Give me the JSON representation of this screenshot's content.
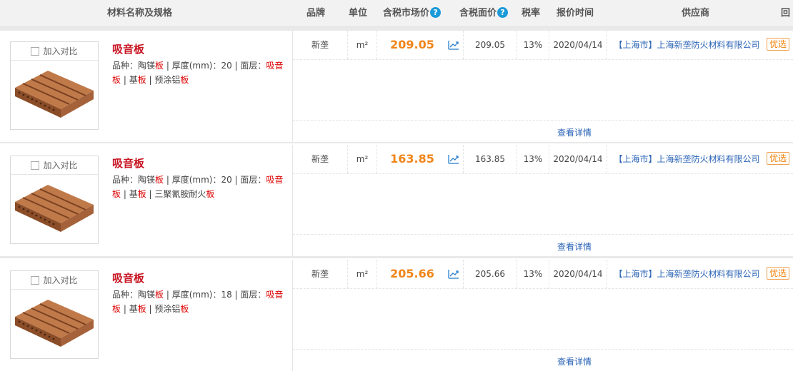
{
  "header": {
    "name_spec": "材料名称及规格",
    "brand": "品牌",
    "unit": "单位",
    "market_price": "含税市场价",
    "list_price": "含税面价",
    "tax_rate": "税率",
    "quote_time": "报价时间",
    "supplier": "供应商",
    "extra": "回"
  },
  "common": {
    "compare_label": "加入对比",
    "detail_label": "查看详情",
    "badge_label": "优选",
    "help_glyph": "?"
  },
  "rows": [
    {
      "title": "吸音板",
      "specs": [
        {
          "t": "品种：陶镁",
          "red": false
        },
        {
          "t": "板",
          "red": true
        },
        {
          "t": " | 厚度(mm)：20 | 面层：",
          "red": false
        },
        {
          "t": "吸音板",
          "red": true
        },
        {
          "t": " | ",
          "red": false
        },
        {
          "t": "基",
          "red": false
        },
        {
          "t": "板",
          "red": true
        },
        {
          "t": " | 预涂铝",
          "red": false
        },
        {
          "t": "板",
          "red": true
        }
      ],
      "brand": "新垄",
      "unit": "m²",
      "market_price": "209.05",
      "list_price": "209.05",
      "tax_rate": "13%",
      "quote_time": "2020/04/14",
      "supplier": "【上海市】上海新垄防火材料有限公司"
    },
    {
      "title": "吸音板",
      "specs": [
        {
          "t": "品种：陶镁",
          "red": false
        },
        {
          "t": "板",
          "red": true
        },
        {
          "t": " | 厚度(mm)：20 | 面层：",
          "red": false
        },
        {
          "t": "吸音板",
          "red": true
        },
        {
          "t": " | ",
          "red": false
        },
        {
          "t": "基",
          "red": false
        },
        {
          "t": "板",
          "red": true
        },
        {
          "t": " | 三聚氰胺耐火",
          "red": false
        },
        {
          "t": "板",
          "red": true
        }
      ],
      "brand": "新垄",
      "unit": "m²",
      "market_price": "163.85",
      "list_price": "163.85",
      "tax_rate": "13%",
      "quote_time": "2020/04/14",
      "supplier": "【上海市】上海新垄防火材料有限公司"
    },
    {
      "title": "吸音板",
      "specs": [
        {
          "t": "品种：陶镁",
          "red": false
        },
        {
          "t": "板",
          "red": true
        },
        {
          "t": " | 厚度(mm)：18 | 面层：",
          "red": false
        },
        {
          "t": "吸音板",
          "red": true
        },
        {
          "t": " | ",
          "red": false
        },
        {
          "t": "基",
          "red": false
        },
        {
          "t": "板",
          "red": true
        },
        {
          "t": " | 预涂铝",
          "red": false
        },
        {
          "t": "板",
          "red": true
        }
      ],
      "brand": "新垄",
      "unit": "m²",
      "market_price": "205.66",
      "list_price": "205.66",
      "tax_rate": "13%",
      "quote_time": "2020/04/14",
      "supplier": "【上海市】上海新垄防火材料有限公司"
    }
  ],
  "colors": {
    "price": "#f08519",
    "title": "#c81623",
    "link": "#2a63b6",
    "highlight": "#dd0000",
    "help_icon": "#1a9ad8"
  },
  "icons": {
    "help": "question-circle-icon",
    "trend": "trend-chart-icon",
    "checkbox": "checkbox-icon",
    "product": "wood-acoustic-board-image"
  }
}
